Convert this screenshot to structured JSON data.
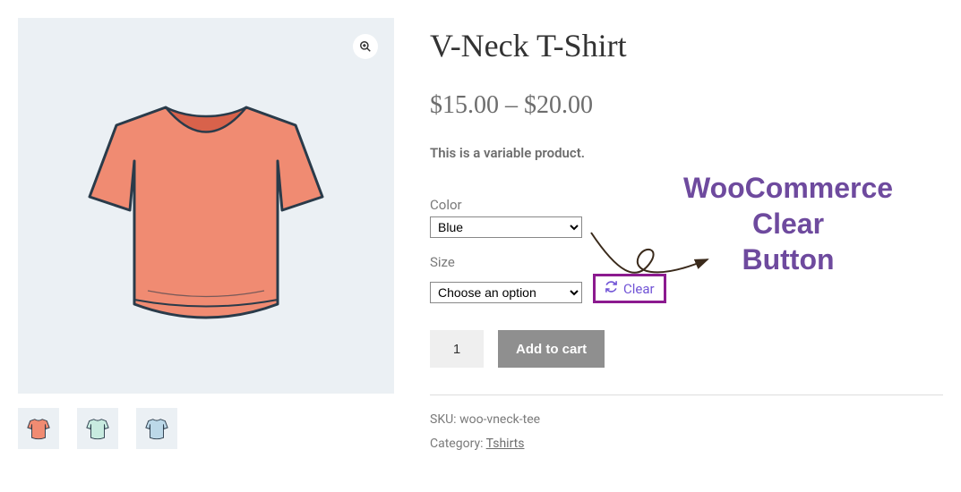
{
  "product": {
    "title": "V-Neck T-Shirt",
    "price": "$15.00 – $20.00",
    "short_desc": "This is a variable product.",
    "variations": {
      "color": {
        "label": "Color",
        "selected": "Blue"
      },
      "size": {
        "label": "Size",
        "selected": "Choose an option"
      }
    },
    "clear_label": "Clear",
    "quantity": "1",
    "add_to_cart_label": "Add to cart",
    "meta": {
      "sku_label": "SKU:",
      "sku_value": "woo-vneck-tee",
      "category_label": "Category:",
      "category_value": "Tshirts"
    }
  },
  "gallery": {
    "main_color": "#f08b72",
    "thumbs": [
      {
        "color": "#f08b72"
      },
      {
        "color": "#c8ebe0"
      },
      {
        "color": "#bcd8e8"
      }
    ]
  },
  "annotation": {
    "line1": "WooCommerce",
    "line2": "Clear",
    "line3": "Button"
  }
}
